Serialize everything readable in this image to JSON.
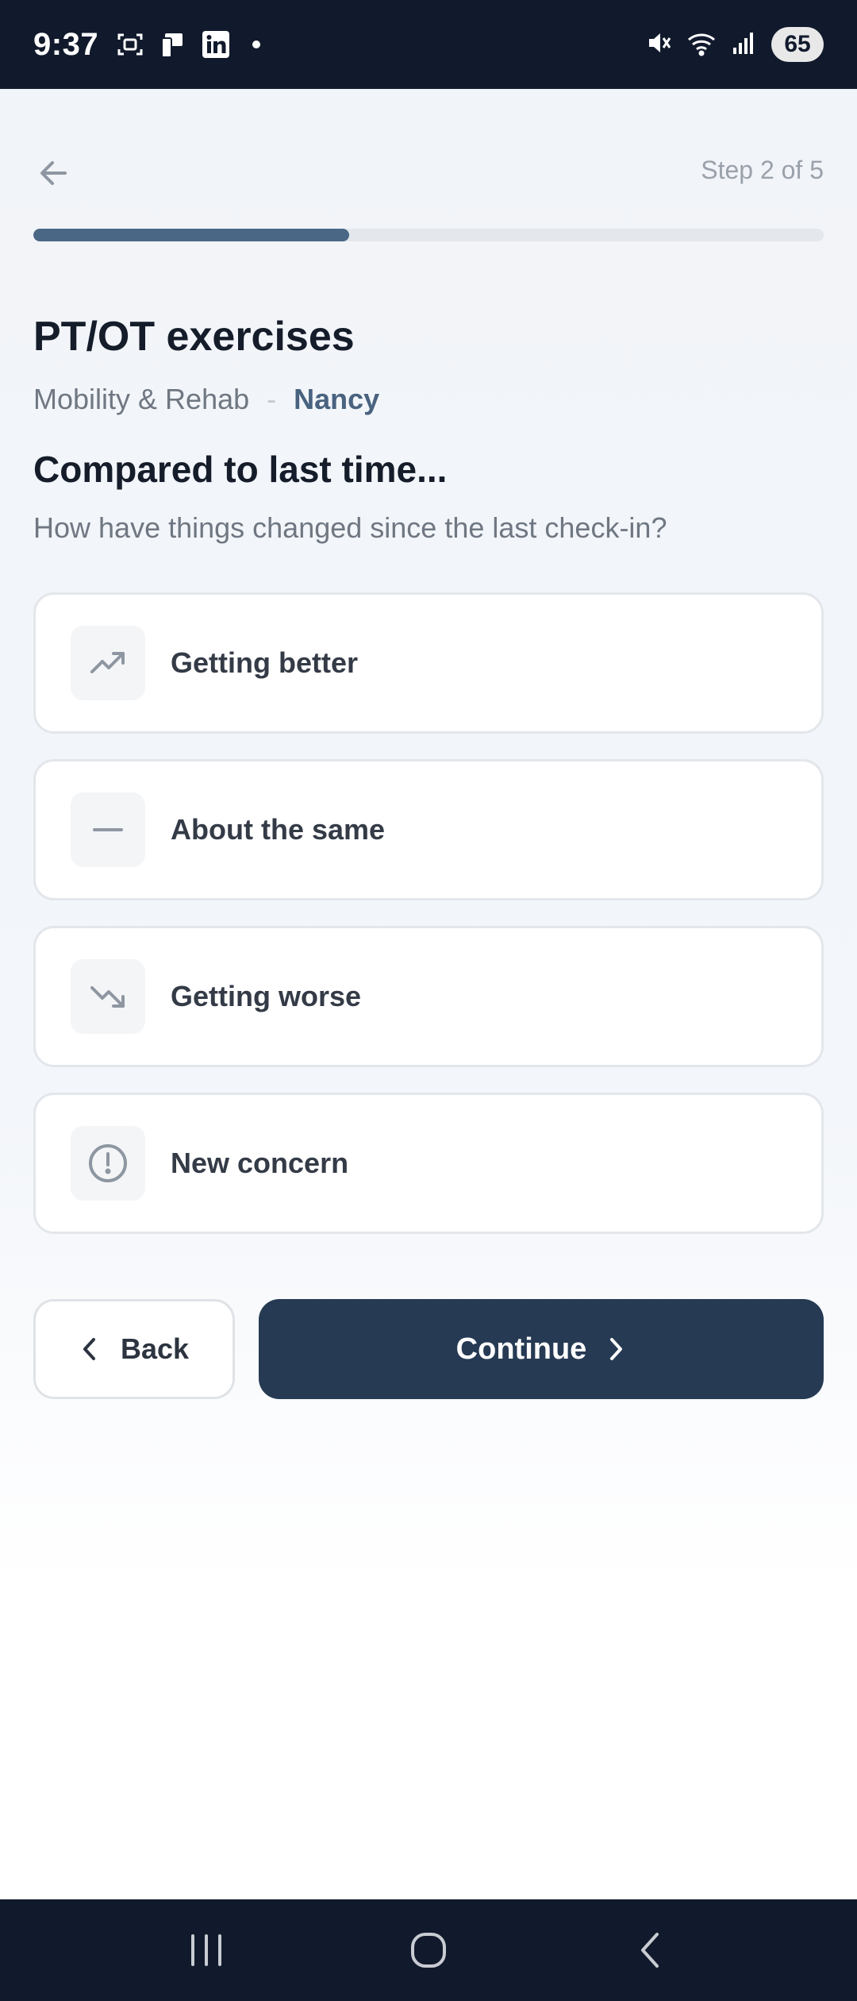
{
  "status_bar": {
    "time": "9:37",
    "battery": "65",
    "icons": [
      "screenshot-icon",
      "device-icon",
      "linkedin-icon",
      "mute-icon",
      "wifi-icon",
      "signal-icon"
    ]
  },
  "header": {
    "step": "Step 2 of 5",
    "progress_fraction": 0.4
  },
  "title": "PT/OT exercises",
  "subtitle": {
    "category": "Mobility & Rehab",
    "separator": "-",
    "person": "Nancy"
  },
  "question": {
    "heading": "Compared to last time...",
    "subheading": "How have things changed since the last check-in?"
  },
  "options": [
    {
      "label": "Getting better",
      "icon": "trend-up-icon"
    },
    {
      "label": "About the same",
      "icon": "minus-icon"
    },
    {
      "label": "Getting worse",
      "icon": "trend-down-icon"
    },
    {
      "label": "New concern",
      "icon": "alert-circle-icon"
    }
  ],
  "buttons": {
    "back": "Back",
    "continue": "Continue"
  },
  "colors": {
    "accent": "#263a53",
    "progress": "#4a6785",
    "link": "#48627f"
  }
}
